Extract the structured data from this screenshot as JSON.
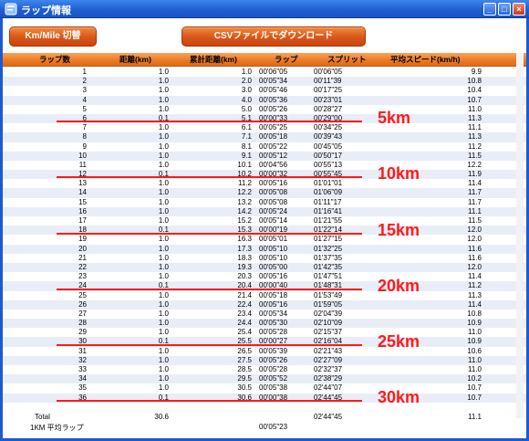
{
  "window": {
    "title": "ラップ情報",
    "icon": "app-icon",
    "controls": [
      "minimize",
      "maximize",
      "close"
    ]
  },
  "toolbar": {
    "unit_toggle_label": "Km/Mile 切替",
    "csv_download_label": "CSVファイルでダウンロード"
  },
  "table": {
    "headers": [
      "ラップ数",
      "距離(km)",
      "累計距離(km)",
      "ラップ",
      "スプリット",
      "平均スピード(km/h)"
    ],
    "rows": [
      [
        "1",
        "1.0",
        "1.0",
        "00'06\"05",
        "00'06\"05",
        "9.9"
      ],
      [
        "2",
        "1.0",
        "2.0",
        "00'05\"34",
        "00'11\"39",
        "10.8"
      ],
      [
        "3",
        "1.0",
        "3.0",
        "00'05\"46",
        "00'17\"25",
        "10.4"
      ],
      [
        "4",
        "1.0",
        "4.0",
        "00'05\"36",
        "00'23\"01",
        "10.7"
      ],
      [
        "5",
        "1.0",
        "5.0",
        "00'05\"26",
        "00'28\"27",
        "11.0"
      ],
      [
        "6",
        "0.1",
        "5.1",
        "00'00\"33",
        "00'29\"00",
        "11.3"
      ],
      [
        "7",
        "1.0",
        "6.1",
        "00'05\"25",
        "00'34\"25",
        "11.1"
      ],
      [
        "8",
        "1.0",
        "7.1",
        "00'05\"18",
        "00'39\"43",
        "11.3"
      ],
      [
        "9",
        "1.0",
        "8.1",
        "00'05\"22",
        "00'45\"05",
        "11.2"
      ],
      [
        "10",
        "1.0",
        "9.1",
        "00'05\"12",
        "00'50\"17",
        "11.5"
      ],
      [
        "11",
        "1.0",
        "10.1",
        "00'04\"56",
        "00'55\"13",
        "12.2"
      ],
      [
        "12",
        "0.1",
        "10.2",
        "00'00\"32",
        "00'55\"45",
        "11.9"
      ],
      [
        "13",
        "1.0",
        "11.2",
        "00'05\"16",
        "01'01\"01",
        "11.4"
      ],
      [
        "14",
        "1.0",
        "12.2",
        "00'05\"08",
        "01'06\"09",
        "11.7"
      ],
      [
        "15",
        "1.0",
        "13.2",
        "00'05\"08",
        "01'11\"17",
        "11.7"
      ],
      [
        "16",
        "1.0",
        "14.2",
        "00'05\"24",
        "01'16\"41",
        "11.1"
      ],
      [
        "17",
        "1.0",
        "15.2",
        "00'05\"14",
        "01'21\"55",
        "11.5"
      ],
      [
        "18",
        "0.1",
        "15.3",
        "00'00\"19",
        "01'22\"14",
        "12.0"
      ],
      [
        "19",
        "1.0",
        "16.3",
        "00'05\"01",
        "01'27\"15",
        "12.0"
      ],
      [
        "20",
        "1.0",
        "17.3",
        "00'05\"10",
        "01'32\"25",
        "11.6"
      ],
      [
        "21",
        "1.0",
        "18.3",
        "00'05\"10",
        "01'37\"35",
        "11.6"
      ],
      [
        "22",
        "1.0",
        "19.3",
        "00'05\"00",
        "01'42\"35",
        "12.0"
      ],
      [
        "23",
        "1.0",
        "20.3",
        "00'05\"16",
        "01'47\"51",
        "11.4"
      ],
      [
        "24",
        "0.1",
        "20.4",
        "00'00\"40",
        "01'48\"31",
        "11.2"
      ],
      [
        "25",
        "1.0",
        "21.4",
        "00'05\"18",
        "01'53\"49",
        "11.3"
      ],
      [
        "26",
        "1.0",
        "22.4",
        "00'05\"16",
        "01'59\"05",
        "11.4"
      ],
      [
        "27",
        "1.0",
        "23.4",
        "00'05\"34",
        "02'04\"39",
        "10.8"
      ],
      [
        "28",
        "1.0",
        "24.4",
        "00'05\"30",
        "02'10\"09",
        "10.9"
      ],
      [
        "29",
        "1.0",
        "25.4",
        "00'05\"28",
        "02'15\"37",
        "11.0"
      ],
      [
        "30",
        "0.1",
        "25.5",
        "00'00\"27",
        "02'16\"04",
        "10.9"
      ],
      [
        "31",
        "1.0",
        "26.5",
        "00'05\"39",
        "02'21\"43",
        "10.6"
      ],
      [
        "32",
        "1.0",
        "27.5",
        "00'05\"26",
        "02'27\"09",
        "11.0"
      ],
      [
        "33",
        "1.0",
        "28.5",
        "00'05\"28",
        "02'32\"37",
        "11.0"
      ],
      [
        "34",
        "1.0",
        "29.5",
        "00'05\"52",
        "02'38\"29",
        "10.2"
      ],
      [
        "35",
        "1.0",
        "30.5",
        "00'05\"38",
        "02'44\"07",
        "10.7"
      ],
      [
        "36",
        "0.1",
        "30.6",
        "00'00\"38",
        "02'44\"45",
        "10.7"
      ]
    ],
    "total": {
      "label": "Total",
      "distance": "30.6",
      "split": "02'44\"45",
      "speed": "11.1"
    },
    "average": {
      "label": "1KM 平均ラップ",
      "lap": "00'05\"23"
    }
  },
  "markers": [
    "5km",
    "10km",
    "15km",
    "20km",
    "25km",
    "30km"
  ],
  "colors": {
    "title_bar": "#1f5fd0",
    "button_orange": "#d9561a",
    "header_orange": "#ea7a24",
    "row_stripe": "#e9edf7",
    "marker_red": "#ff1a1a"
  }
}
